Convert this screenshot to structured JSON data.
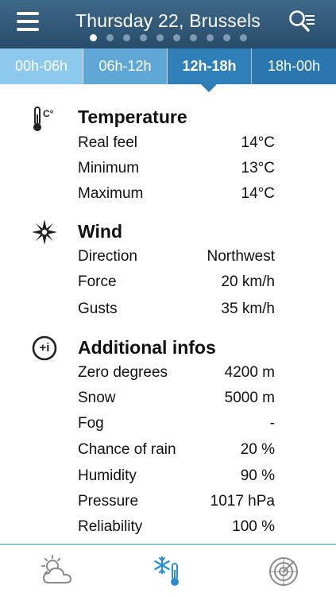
{
  "header": {
    "title": "Thursday 22, Brussels",
    "page_count": 10,
    "active_page": 0
  },
  "tabs": [
    {
      "label": "00h-06h"
    },
    {
      "label": "06h-12h"
    },
    {
      "label": "12h-18h"
    },
    {
      "label": "18h-00h"
    }
  ],
  "active_tab": 2,
  "sections": {
    "temperature": {
      "title": "Temperature",
      "icon": "thermometer-celsius-icon",
      "icon_text": "C°",
      "rows": [
        {
          "label": "Real feel",
          "value": "14°C"
        },
        {
          "label": "Minimum",
          "value": "13°C"
        },
        {
          "label": "Maximum",
          "value": "14°C"
        }
      ]
    },
    "wind": {
      "title": "Wind",
      "icon": "compass-rose-icon",
      "rows": [
        {
          "label": "Direction",
          "value": "Northwest"
        },
        {
          "label": "Force",
          "value": "20 km/h"
        },
        {
          "label": "Gusts",
          "value": "35 km/h"
        }
      ]
    },
    "additional": {
      "title": "Additional infos",
      "icon": "info-plus-icon",
      "icon_text": "+i",
      "rows": [
        {
          "label": "Zero degrees",
          "value": "4200 m"
        },
        {
          "label": "Snow",
          "value": "5000 m"
        },
        {
          "label": "Fog",
          "value": "-"
        },
        {
          "label": "Chance of rain",
          "value": "20 %"
        },
        {
          "label": "Humidity",
          "value": "90 %"
        },
        {
          "label": "Pressure",
          "value": "1017 hPa"
        },
        {
          "label": "Reliability",
          "value": "100 %"
        }
      ]
    }
  },
  "bottom_bar": [
    {
      "name": "forecast-tab",
      "icon": "sun-cloud-icon",
      "active": false
    },
    {
      "name": "details-tab",
      "icon": "snowflake-thermometer-icon",
      "active": true
    },
    {
      "name": "radar-tab",
      "icon": "radar-icon",
      "active": false
    }
  ],
  "colors": {
    "header": "#2f5677",
    "accent": "#2a8fd0",
    "tab_light": "#8cc9ec",
    "tab_mid": "#5ea7d6",
    "tab_active": "#2f7fb8",
    "icon_gray": "#8a8a8a"
  }
}
